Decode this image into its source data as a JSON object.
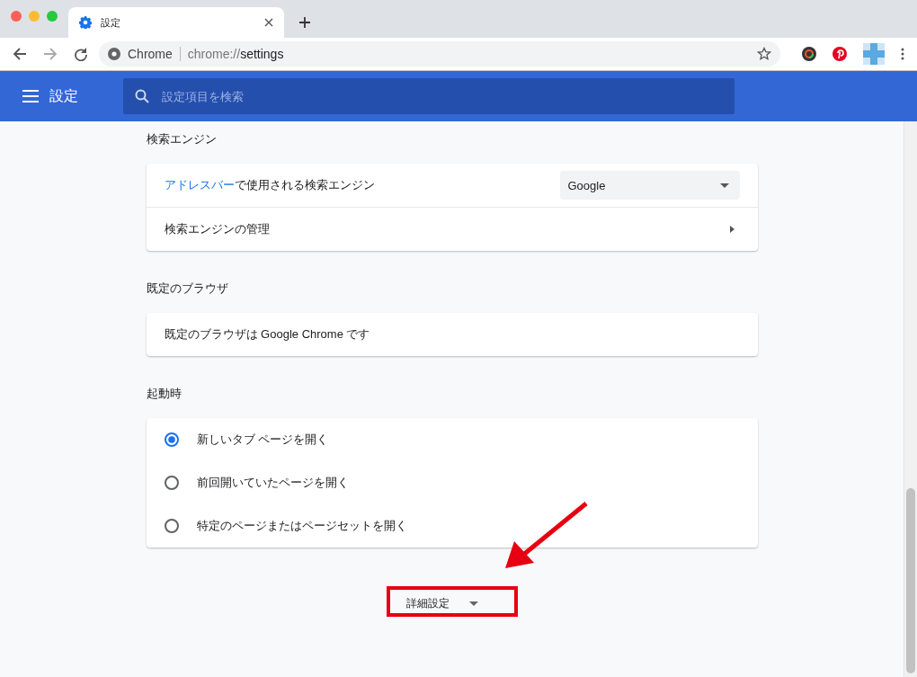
{
  "tab": {
    "title": "設定",
    "selected": true
  },
  "toolbar": {
    "site_label": "Chrome",
    "url_prefix": "chrome://",
    "url_path": "settings"
  },
  "header": {
    "title": "設定",
    "search": {
      "placeholder": "設定項目を検索"
    }
  },
  "sections": [
    {
      "heading": "検索エンジン",
      "rows": [
        {
          "kind": "dropdown",
          "link": "アドレスバー",
          "text": "で使用される検索エンジン",
          "value": "Google"
        },
        {
          "kind": "arrow",
          "text": "検索エンジンの管理"
        }
      ]
    },
    {
      "heading": "既定のブラウザ",
      "rows": [
        {
          "kind": "text",
          "text": "既定のブラウザは Google Chrome です"
        }
      ]
    },
    {
      "heading": "起動時",
      "rows": [
        {
          "kind": "radio",
          "text": "新しいタブ ページを開く",
          "selected": true
        },
        {
          "kind": "radio",
          "text": "前回開いていたページを開く",
          "selected": false
        },
        {
          "kind": "radio",
          "text": "特定のページまたはページセットを開く",
          "selected": false
        }
      ]
    }
  ],
  "advanced_button": {
    "label": "詳細設定"
  }
}
